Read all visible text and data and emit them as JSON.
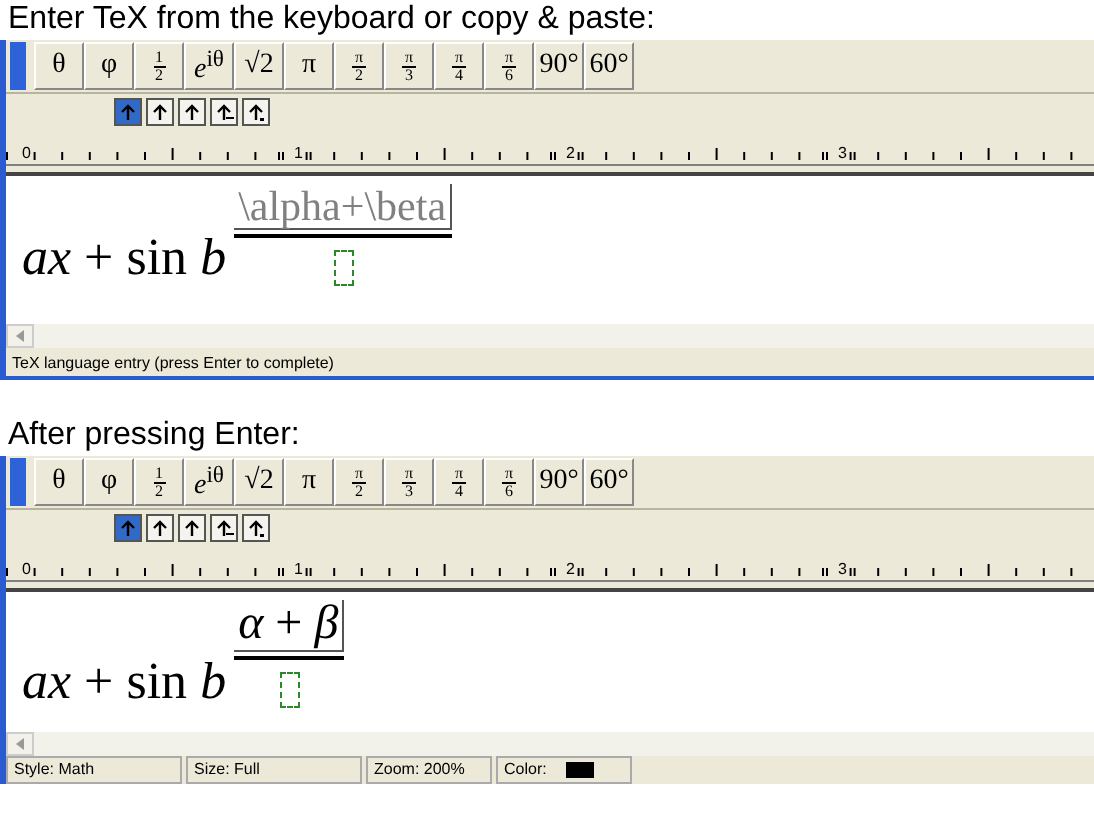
{
  "panels": [
    {
      "heading": "Enter TeX from the keyboard or copy & paste:",
      "toolbar": [
        {
          "kind": "symbol",
          "text": "θ"
        },
        {
          "kind": "symbol",
          "text": "φ"
        },
        {
          "kind": "fraction",
          "numerator": "1",
          "denominator": "2"
        },
        {
          "kind": "rich",
          "text": "*e*$^{iθ}$"
        },
        {
          "kind": "symbol",
          "text": "√2"
        },
        {
          "kind": "symbol",
          "text": "π"
        },
        {
          "kind": "fraction",
          "numerator": "π",
          "denominator": "2"
        },
        {
          "kind": "fraction",
          "numerator": "π",
          "denominator": "3"
        },
        {
          "kind": "fraction",
          "numerator": "π",
          "denominator": "4"
        },
        {
          "kind": "fraction",
          "numerator": "π",
          "denominator": "6"
        },
        {
          "kind": "symbol",
          "text": "90°"
        },
        {
          "kind": "symbol",
          "text": "60°"
        }
      ],
      "nudge_buttons": [
        {
          "selected": true
        },
        {
          "selected": false
        },
        {
          "selected": false
        },
        {
          "selected": false
        },
        {
          "selected": false
        }
      ],
      "ruler": [
        "0",
        "1",
        "2",
        "3"
      ],
      "equation": {
        "base": "*ax* + sin *b*",
        "numerator": {
          "kind": "tex_entry",
          "text": "\\alpha+\\beta"
        }
      },
      "status_bar": [
        {
          "text": "TeX language entry (press Enter to complete)"
        }
      ]
    },
    {
      "heading": "After pressing Enter:",
      "toolbar": [
        {
          "kind": "symbol",
          "text": "θ"
        },
        {
          "kind": "symbol",
          "text": "φ"
        },
        {
          "kind": "fraction",
          "numerator": "1",
          "denominator": "2"
        },
        {
          "kind": "rich",
          "text": "*e*$^{iθ}$"
        },
        {
          "kind": "symbol",
          "text": "√2"
        },
        {
          "kind": "symbol",
          "text": "π"
        },
        {
          "kind": "fraction",
          "numerator": "π",
          "denominator": "2"
        },
        {
          "kind": "fraction",
          "numerator": "π",
          "denominator": "3"
        },
        {
          "kind": "fraction",
          "numerator": "π",
          "denominator": "4"
        },
        {
          "kind": "fraction",
          "numerator": "π",
          "denominator": "6"
        },
        {
          "kind": "symbol",
          "text": "90°"
        },
        {
          "kind": "symbol",
          "text": "60°"
        }
      ],
      "nudge_buttons": [
        {
          "selected": true
        },
        {
          "selected": false
        },
        {
          "selected": false
        },
        {
          "selected": false
        },
        {
          "selected": false
        }
      ],
      "ruler": [
        "0",
        "1",
        "2",
        "3"
      ],
      "equation": {
        "base": "*ax* + sin *b*",
        "numerator": {
          "kind": "math",
          "text": "*α* + *β*"
        }
      },
      "status_bar": [
        {
          "text": "Style: Math"
        },
        {
          "text": "Size: Full"
        },
        {
          "text": "Zoom: 200%"
        },
        {
          "text": "Color:",
          "color": "#000000"
        }
      ]
    }
  ]
}
